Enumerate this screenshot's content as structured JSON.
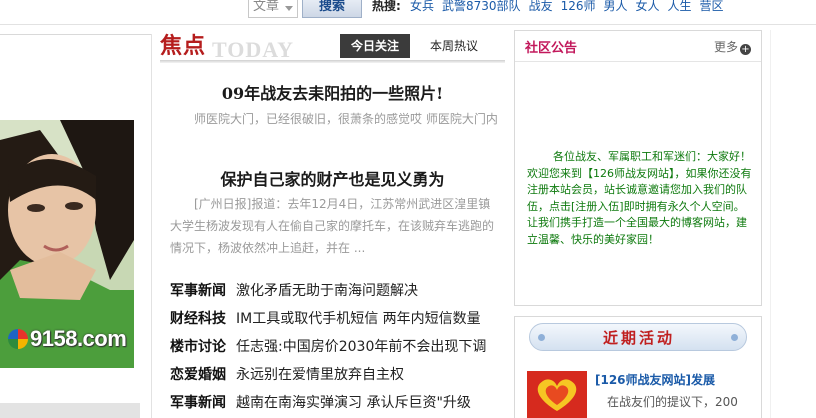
{
  "search": {
    "select_value": "文章",
    "button_label": "搜索",
    "hot_label": "热搜:",
    "hot_links": [
      "女兵",
      "武警8730部队",
      "战友",
      "126师",
      "男人",
      "女人",
      "人生",
      "营区"
    ]
  },
  "left": {
    "photo_logo_text": "9158.com"
  },
  "focus": {
    "logo_cn": "焦点",
    "logo_en": "TODAY",
    "tabs": [
      "今日关注",
      "本周热议"
    ],
    "stories": [
      {
        "headline": "09年战友去耒阳拍的一些照片!",
        "summary": "师医院大门，已经很破旧，很萧条的感觉哎 师医院大门内"
      },
      {
        "headline": "保护自己家的财产也是见义勇为",
        "summary": "[广州日报]报道：去年12月4日，江苏常州武进区湟里镇大学生杨波发现有人在偷自己家的摩托车，在该贼弃车逃跑的情况下，杨波依然冲上追赶，并在 ..."
      }
    ],
    "news": [
      {
        "category": "军事新闻",
        "title": "激化矛盾无助于南海问题解决"
      },
      {
        "category": "财经科技",
        "title": "IM工具或取代手机短信 两年内短信数量"
      },
      {
        "category": "楼市讨论",
        "title": "任志强:中国房价2030年前不会出现下调"
      },
      {
        "category": "恋爱婚姻",
        "title": "永远别在爱情里放弃自主权"
      },
      {
        "category": "军事新闻",
        "title": "越南在南海实弹演习 承认斥巨资\"升级"
      }
    ]
  },
  "notice": {
    "title": "社区公告",
    "more_label": "更多",
    "text": "各位战友、军属职工和军迷们：大家好！欢迎您来到【126师战友网站】，如果你还没有注册本站会员，站长诚意邀请您加入我们的队伍，点击[注册入伍]即时拥有永久个人空间。让我们携手打造一个全国最大的博客网站，建立温馨、快乐的美好家园！"
  },
  "activity": {
    "title": "近期活动",
    "link": "[126师战友网站]发展",
    "desc": "在战友们的提议下，200"
  },
  "colors": {
    "accent_red": "#b51d1d",
    "notice_pink": "#c2185b",
    "notice_green": "#0e7a0e",
    "link_blue": "#1a5aa8"
  }
}
